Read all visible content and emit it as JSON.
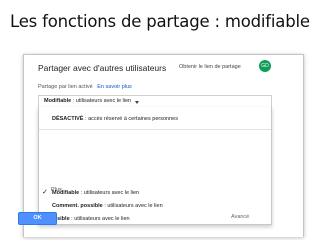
{
  "slide_title": "Les fonctions de partage : modifiable",
  "dialog": {
    "title": "Partager avec d'autres utilisateurs",
    "share_link_label": "Obtenir le lien de partage",
    "share_link_icon": "link-icon",
    "link_icon_glyph": "GD",
    "sub_label": "Partage par lien activé",
    "learn_more": "En savoir plus",
    "selected": {
      "bold": "Modifiable",
      "rest": " : utilisateurs avec le lien"
    },
    "menu_items": [
      {
        "bold": "DÉSACTIVÉ",
        "rest": " : accès réservé à certaines personnes"
      },
      {
        "bold": "Modifiable",
        "rest": " : utilisateurs avec le lien",
        "checked": true
      },
      {
        "bold": "Comment. possible",
        "rest": " : utilisateurs avec le lien"
      },
      {
        "bold": "Visible",
        "rest": " : utilisateurs avec le lien"
      }
    ],
    "more_label": "Plus...",
    "check_glyph": "✓",
    "ok_label": "OK",
    "advanced_label": "Avancé"
  },
  "colors": {
    "accent": "#4d90fe",
    "link": "#1155cc",
    "link_icon_bg": "#0f9d58"
  }
}
